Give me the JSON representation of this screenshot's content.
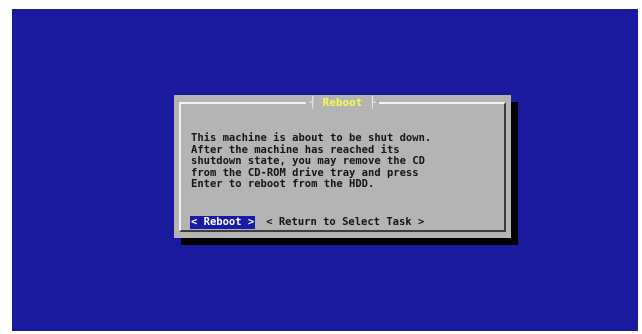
{
  "dialog": {
    "title": "Reboot",
    "title_left_bracket": "┤",
    "title_right_bracket": "├",
    "body_lines": [
      "This machine is about to be shut down.",
      "After the machine has reached its",
      "shutdown state, you may remove the CD",
      "from the CD-ROM drive tray and press",
      "Enter to reboot from the HDD."
    ]
  },
  "buttons": {
    "reboot_label": "< Reboot >",
    "return_label": "< Return to Select Task >"
  },
  "colors": {
    "background": "#1a1a9e",
    "dialog": "#b4b4b4",
    "title_text": "#f8f850",
    "selected_button": "#1a1aa8"
  }
}
